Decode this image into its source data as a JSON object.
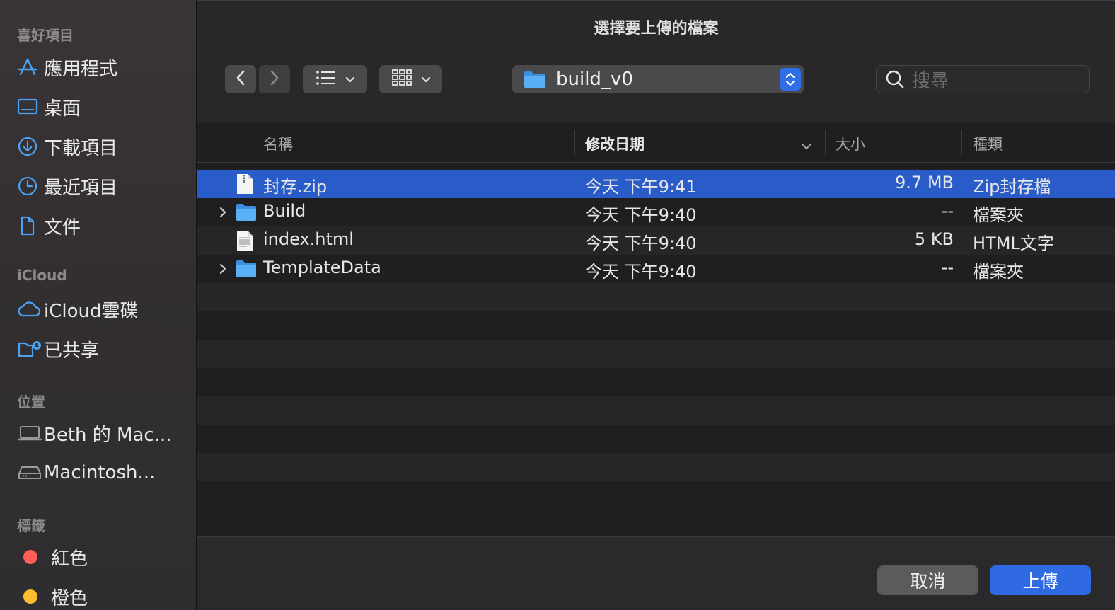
{
  "dialog": {
    "title": "選擇要上傳的檔案"
  },
  "sidebar": {
    "favorites_header": "喜好項目",
    "favorites": [
      {
        "label": "應用程式",
        "icon": "applications-icon"
      },
      {
        "label": "桌面",
        "icon": "desktop-icon"
      },
      {
        "label": "下載項目",
        "icon": "downloads-icon"
      },
      {
        "label": "最近項目",
        "icon": "recents-icon"
      },
      {
        "label": "文件",
        "icon": "documents-icon"
      }
    ],
    "icloud_header": "iCloud",
    "icloud": [
      {
        "label": "iCloud雲碟",
        "icon": "icloud-drive-icon"
      },
      {
        "label": "已共享",
        "icon": "shared-folder-icon"
      }
    ],
    "locations_header": "位置",
    "locations": [
      {
        "label": "Beth 的 Mac...",
        "icon": "laptop-icon"
      },
      {
        "label": "Macintosh...",
        "icon": "hard-drive-icon"
      }
    ],
    "tags_header": "標籤",
    "tags": [
      {
        "label": "紅色",
        "color": "#ff5f57"
      },
      {
        "label": "橙色",
        "color": "#febc2e"
      }
    ]
  },
  "toolbar": {
    "path_label": "build_v0",
    "search_placeholder": "搜尋"
  },
  "columns": {
    "name": "名稱",
    "date": "修改日期",
    "size": "大小",
    "kind": "種類"
  },
  "files": [
    {
      "name": "封存.zip",
      "date": "今天 下午9:41",
      "size": "9.7 MB",
      "kind": "Zip封存檔",
      "type": "zip",
      "selected": true
    },
    {
      "name": "Build",
      "date": "今天 下午9:40",
      "size": "--",
      "kind": "檔案夾",
      "type": "folder",
      "selected": false
    },
    {
      "name": "index.html",
      "date": "今天 下午9:40",
      "size": "5 KB",
      "kind": "HTML文字",
      "type": "html",
      "selected": false
    },
    {
      "name": "TemplateData",
      "date": "今天 下午9:40",
      "size": "--",
      "kind": "檔案夾",
      "type": "folder",
      "selected": false
    }
  ],
  "footer": {
    "cancel_label": "取消",
    "upload_label": "上傳"
  },
  "colors": {
    "accent": "#2f6ae3",
    "selection": "#2a5cc9",
    "icon_blue": "#4aa3f5"
  }
}
